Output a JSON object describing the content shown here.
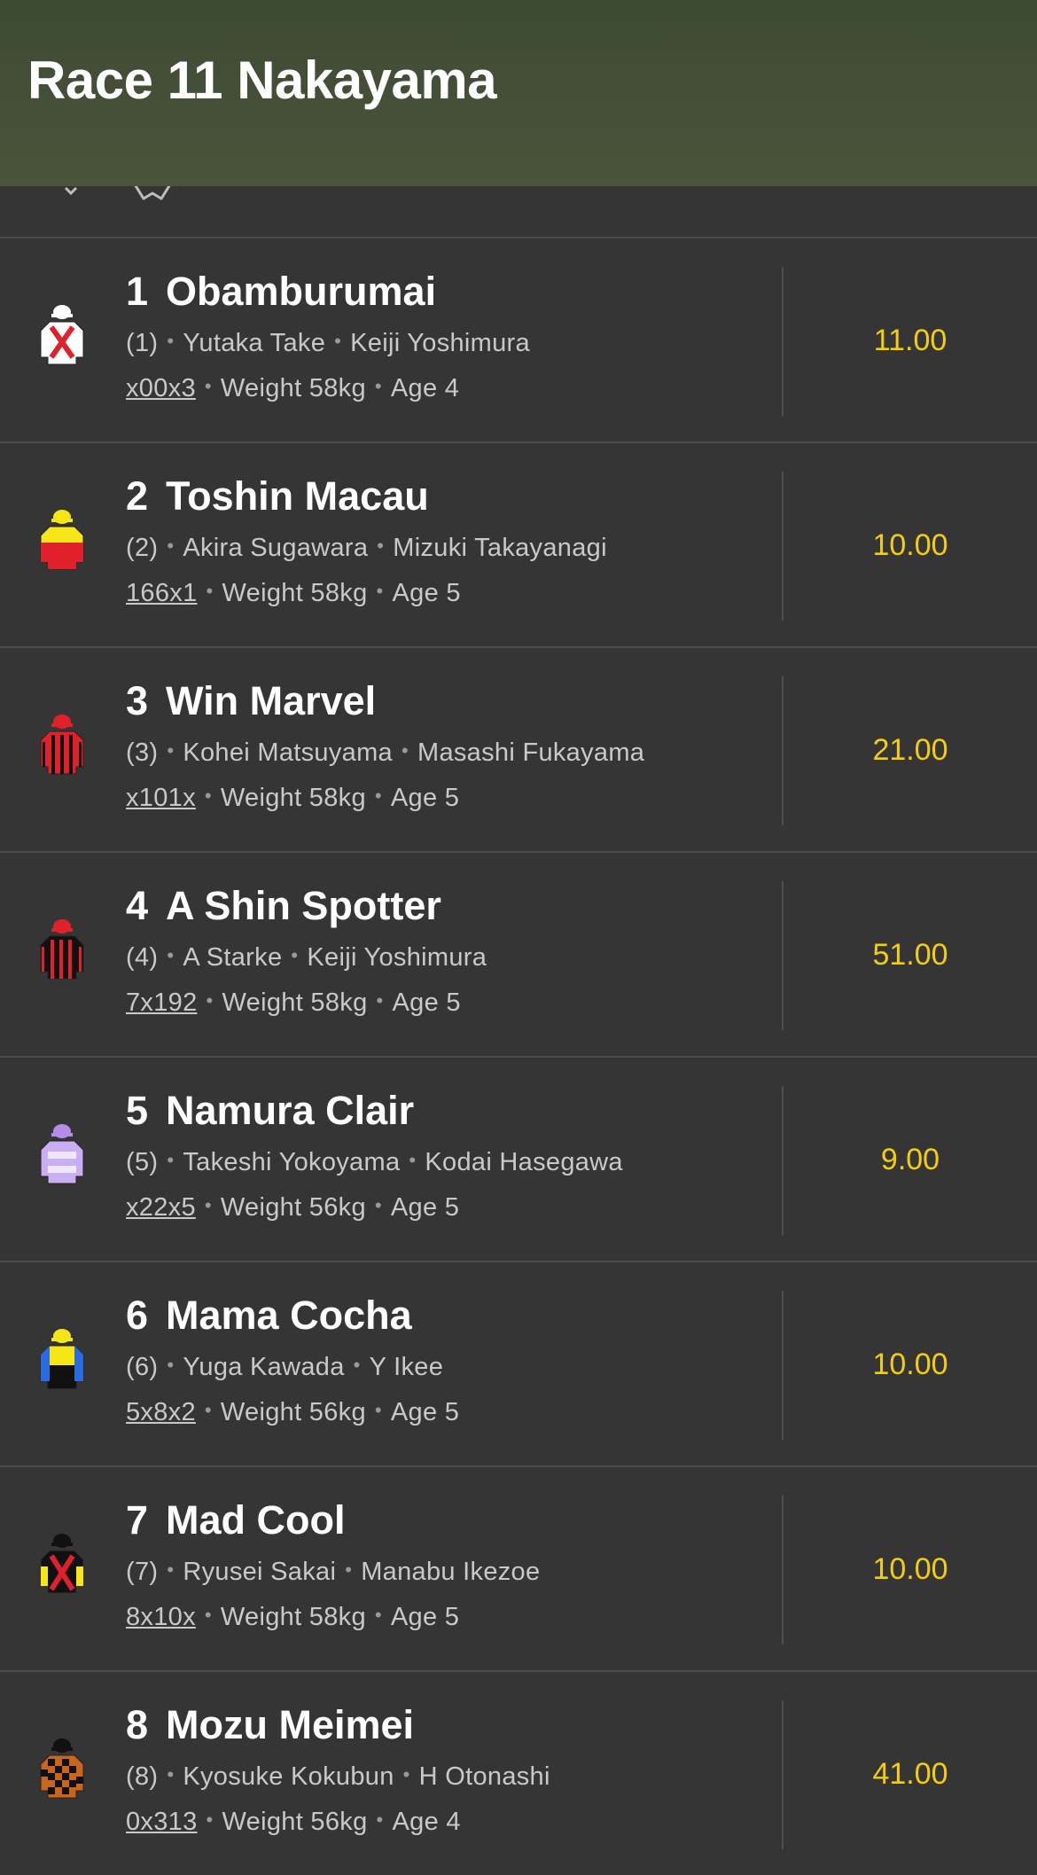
{
  "header": {
    "title": "Race 11 Nakayama"
  },
  "runners": [
    {
      "number": "1",
      "name": "Obamburumai",
      "draw": "(1)",
      "jockey": "Yutaka Take",
      "trainer": "Keiji Yoshimura",
      "form": "x00x3",
      "weight": "Weight 58kg",
      "age": "Age 4",
      "odds": "11.00",
      "silk": "white-red-cross"
    },
    {
      "number": "2",
      "name": "Toshin Macau",
      "draw": "(2)",
      "jockey": "Akira Sugawara",
      "trainer": "Mizuki Takayanagi",
      "form": "166x1",
      "weight": "Weight 58kg",
      "age": "Age 5",
      "odds": "10.00",
      "silk": "yellow-red"
    },
    {
      "number": "3",
      "name": "Win Marvel",
      "draw": "(3)",
      "jockey": "Kohei Matsuyama",
      "trainer": "Masashi Fukayama",
      "form": "x101x",
      "weight": "Weight 58kg",
      "age": "Age 5",
      "odds": "21.00",
      "silk": "red-black-stripes"
    },
    {
      "number": "4",
      "name": "A Shin Spotter",
      "draw": "(4)",
      "jockey": "A Starke",
      "trainer": "Keiji Yoshimura",
      "form": "7x192",
      "weight": "Weight 58kg",
      "age": "Age 5",
      "odds": "51.00",
      "silk": "red-black-stripes"
    },
    {
      "number": "5",
      "name": "Namura Clair",
      "draw": "(5)",
      "jockey": "Takeshi Yokoyama",
      "trainer": "Kodai Hasegawa",
      "form": "x22x5",
      "weight": "Weight 56kg",
      "age": "Age 5",
      "odds": "9.00",
      "silk": "lavender"
    },
    {
      "number": "6",
      "name": "Mama Cocha",
      "draw": "(6)",
      "jockey": "Yuga Kawada",
      "trainer": "Y Ikee",
      "form": "5x8x2",
      "weight": "Weight 56kg",
      "age": "Age 5",
      "odds": "10.00",
      "silk": "yellow-blue-black"
    },
    {
      "number": "7",
      "name": "Mad Cool",
      "draw": "(7)",
      "jockey": "Ryusei Sakai",
      "trainer": "Manabu Ikezoe",
      "form": "8x10x",
      "weight": "Weight 58kg",
      "age": "Age 5",
      "odds": "10.00",
      "silk": "black-yellow-red-cross"
    },
    {
      "number": "8",
      "name": "Mozu Meimei",
      "draw": "(8)",
      "jockey": "Kyosuke Kokubun",
      "trainer": "H Otonashi",
      "form": "0x313",
      "weight": "Weight 56kg",
      "age": "Age 4",
      "odds": "41.00",
      "silk": "black-orange-check"
    }
  ],
  "colors": {
    "background": "#353535",
    "odds": "#f5cd0c",
    "header": "#465039"
  }
}
